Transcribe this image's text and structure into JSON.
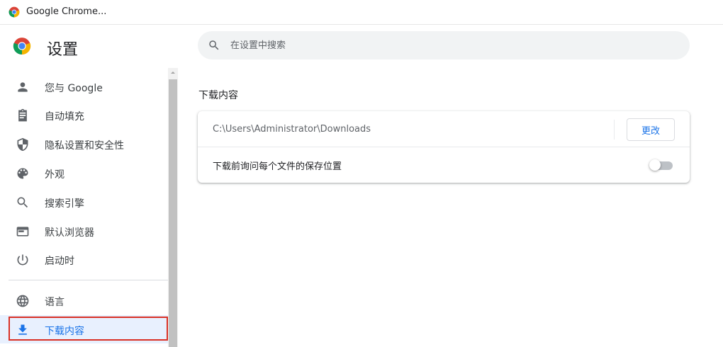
{
  "window": {
    "title": "Google Chrome..."
  },
  "header": {
    "title": "设置"
  },
  "search": {
    "placeholder": "在设置中搜索",
    "value": ""
  },
  "sidebar": {
    "items": [
      {
        "label": "您与 Google",
        "icon": "person-icon"
      },
      {
        "label": "自动填充",
        "icon": "clipboard-icon"
      },
      {
        "label": "隐私设置和安全性",
        "icon": "shield-icon"
      },
      {
        "label": "外观",
        "icon": "palette-icon"
      },
      {
        "label": "搜索引擎",
        "icon": "search-icon"
      },
      {
        "label": "默认浏览器",
        "icon": "browser-icon"
      },
      {
        "label": "启动时",
        "icon": "power-icon"
      },
      {
        "label": "语言",
        "icon": "globe-icon"
      },
      {
        "label": "下载内容",
        "icon": "download-icon",
        "active": true
      }
    ]
  },
  "downloads": {
    "section_title": "下载内容",
    "location_path": "C:\\Users\\Administrator\\Downloads",
    "change_button": "更改",
    "ask_where_label": "下载前询问每个文件的保存位置",
    "ask_where_enabled": false
  },
  "colors": {
    "accent": "#1a73e8",
    "active_bg": "#e8f0fe",
    "highlight_border": "#d93025",
    "toggle_off": "#bdc1c6"
  }
}
